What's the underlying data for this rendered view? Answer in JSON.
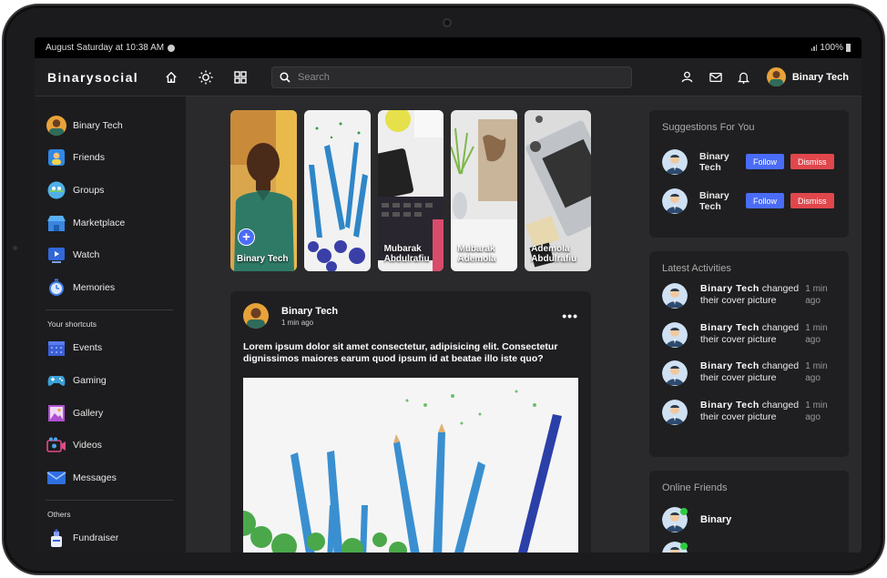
{
  "status": {
    "time": "August Saturday at 10:38 AM",
    "battery": "100%"
  },
  "header": {
    "logo": "Binarysocial",
    "search_placeholder": "Search",
    "user_name": "Binary Tech"
  },
  "sidebar": {
    "main": [
      {
        "label": "Binary Tech",
        "icon": "avatar"
      },
      {
        "label": "Friends",
        "icon": "friends-icon"
      },
      {
        "label": "Groups",
        "icon": "groups-icon"
      },
      {
        "label": "Marketplace",
        "icon": "marketplace-icon"
      },
      {
        "label": "Watch",
        "icon": "watch-icon"
      },
      {
        "label": "Memories",
        "icon": "memories-icon"
      }
    ],
    "shortcuts_title": "Your shortcuts",
    "shortcuts": [
      {
        "label": "Events",
        "icon": "events-icon"
      },
      {
        "label": "Gaming",
        "icon": "gaming-icon"
      },
      {
        "label": "Gallery",
        "icon": "gallery-icon"
      },
      {
        "label": "Videos",
        "icon": "videos-icon"
      },
      {
        "label": "Messages",
        "icon": "messages-icon"
      }
    ],
    "others_title": "Others",
    "others": [
      {
        "label": "Fundraiser",
        "icon": "fundraiser-icon"
      }
    ]
  },
  "stories": [
    {
      "name": "Binary Tech"
    },
    {
      "name": ""
    },
    {
      "name": "Mubarak Abdulrafiu"
    },
    {
      "name": "Mubarak Ademola"
    },
    {
      "name": "Ademola Abdulrafiu"
    }
  ],
  "post": {
    "author": "Binary Tech",
    "time": "1 min ago",
    "text": "Lorem ipsum dolor sit amet consectetur, adipisicing elit. Consectetur dignissimos maiores earum quod ipsum id at beatae illo iste quo?"
  },
  "suggestions": {
    "title": "Suggestions For You",
    "follow_label": "Follow",
    "dismiss_label": "Dismiss",
    "items": [
      {
        "name": "Binary Tech"
      },
      {
        "name": "Binary Tech"
      }
    ]
  },
  "activities": {
    "title": "Latest Activities",
    "items": [
      {
        "name": "Binary Tech",
        "action": "changed their cover picture",
        "time": "1 min ago"
      },
      {
        "name": "Binary Tech",
        "action": "changed their cover picture",
        "time": "1 min ago"
      },
      {
        "name": "Binary Tech",
        "action": "changed their cover picture",
        "time": "1 min ago"
      },
      {
        "name": "Binary Tech",
        "action": "changed their cover picture",
        "time": "1 min ago"
      }
    ]
  },
  "online": {
    "title": "Online Friends",
    "items": [
      {
        "name": "Binary"
      },
      {
        "name": ""
      }
    ]
  },
  "colors": {
    "accent": "#4a6cf7",
    "dismiss": "#e0474c",
    "online": "#2ecc40"
  }
}
